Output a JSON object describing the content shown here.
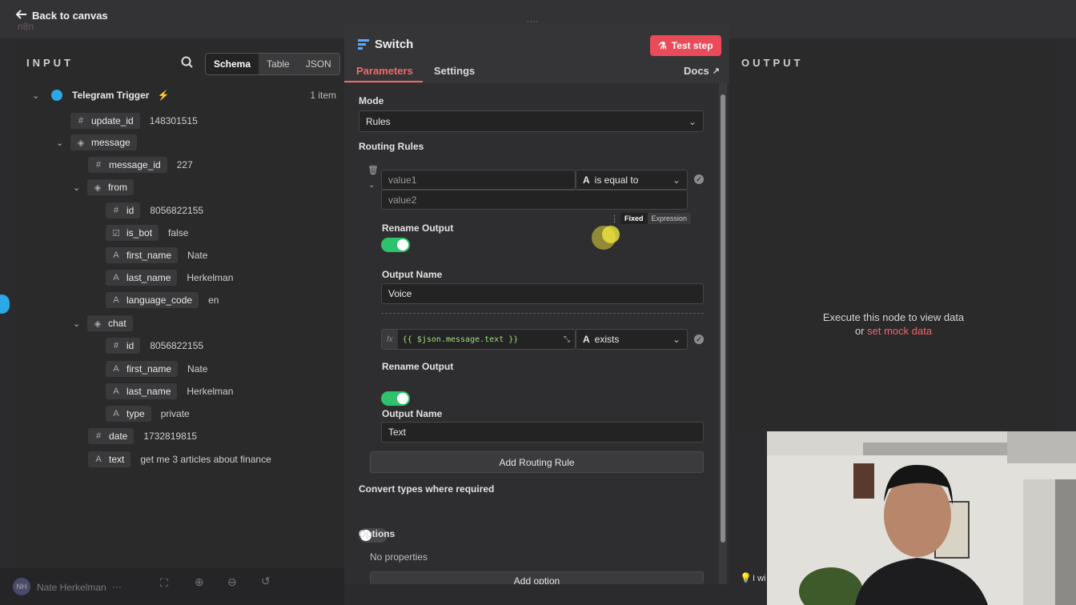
{
  "topbar": {
    "back_label": "Back to canvas",
    "logo_text": "n8n",
    "drag_handle": "::::"
  },
  "input": {
    "title": "INPUT",
    "view_tabs": [
      "Schema",
      "Table",
      "JSON"
    ],
    "trigger_name": "Telegram Trigger",
    "item_count": "1 item",
    "rows": [
      {
        "type": "#",
        "key": "update_id",
        "value": "148301515"
      },
      {
        "type": "obj",
        "key": "message",
        "value": ""
      },
      {
        "type": "#",
        "key": "message_id",
        "value": "227"
      },
      {
        "type": "obj",
        "key": "from",
        "value": ""
      },
      {
        "type": "#",
        "key": "id",
        "value": "8056822155"
      },
      {
        "type": "bool",
        "key": "is_bot",
        "value": "false"
      },
      {
        "type": "A",
        "key": "first_name",
        "value": "Nate"
      },
      {
        "type": "A",
        "key": "last_name",
        "value": "Herkelman"
      },
      {
        "type": "A",
        "key": "language_code",
        "value": "en"
      },
      {
        "type": "obj",
        "key": "chat",
        "value": ""
      },
      {
        "type": "#",
        "key": "id",
        "value": "8056822155"
      },
      {
        "type": "A",
        "key": "first_name",
        "value": "Nate"
      },
      {
        "type": "A",
        "key": "last_name",
        "value": "Herkelman"
      },
      {
        "type": "A",
        "key": "type",
        "value": "private"
      },
      {
        "type": "#",
        "key": "date",
        "value": "1732819815"
      },
      {
        "type": "A",
        "key": "text",
        "value": "get me 3 articles about finance"
      }
    ]
  },
  "node": {
    "title": "Switch",
    "test_step": "Test step",
    "tabs": [
      "Parameters",
      "Settings"
    ],
    "docs": "Docs",
    "mode_label": "Mode",
    "mode_value": "Rules",
    "routing_rules_label": "Routing Rules",
    "rule1": {
      "value1_placeholder": "value1",
      "operator": "is equal to",
      "value2_placeholder": "value2",
      "fixed": "Fixed",
      "expression": "Expression",
      "rename_label": "Rename Output",
      "output_name_label": "Output Name",
      "output_name": "Voice"
    },
    "rule2": {
      "fx": "fx",
      "expression": "{{ $json.message.text }}",
      "operator": "exists",
      "rename_label": "Rename Output",
      "output_name_label": "Output Name",
      "output_name": "Text"
    },
    "add_rule": "Add Routing Rule",
    "convert_label": "Convert types where required",
    "options_label": "Options",
    "no_properties": "No properties",
    "add_option": "Add option"
  },
  "output": {
    "title": "OUTPUT",
    "exec_msg": "Execute this node to view data",
    "or": "or",
    "mock_link": "set mock data"
  },
  "footer": {
    "user_name": "Nate Herkelman",
    "user_initials": "NH",
    "more": "···",
    "hint": "I wi"
  }
}
